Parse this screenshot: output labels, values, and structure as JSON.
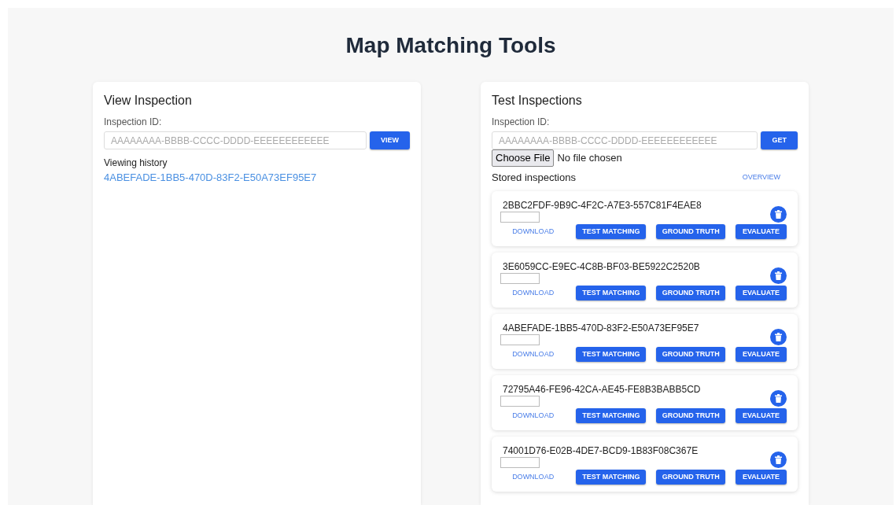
{
  "title": "Map Matching Tools",
  "view_inspection": {
    "heading": "View Inspection",
    "label": "Inspection ID:",
    "placeholder": "AAAAAAAA-BBBB-CCCC-DDDD-EEEEEEEEEEEE",
    "button": "VIEW",
    "history_label": "Viewing history",
    "history": [
      "4ABEFADE-1BB5-470D-83F2-E50A73EF95E7"
    ]
  },
  "test_inspections": {
    "heading": "Test Inspections",
    "label": "Inspection ID:",
    "placeholder": "AAAAAAAA-BBBB-CCCC-DDDD-EEEEEEEEEEEE",
    "button": "GET",
    "file_button": "Choose File",
    "file_status": "No file chosen",
    "stored_label": "Stored inspections",
    "overview": "OVERVIEW",
    "stored": [
      {
        "id": "2BBC2FDF-9B9C-4F2C-A7E3-557C81F4EAE8",
        "download": "DOWNLOAD",
        "actions": [
          "TEST MATCHING",
          "GROUND TRUTH",
          "EVALUATE"
        ]
      },
      {
        "id": "3E6059CC-E9EC-4C8B-BF03-BE5922C2520B",
        "download": "DOWNLOAD",
        "actions": [
          "TEST MATCHING",
          "GROUND TRUTH",
          "EVALUATE"
        ]
      },
      {
        "id": "4ABEFADE-1BB5-470D-83F2-E50A73EF95E7",
        "download": "DOWNLOAD",
        "actions": [
          "TEST MATCHING",
          "GROUND TRUTH",
          "EVALUATE"
        ]
      },
      {
        "id": "72795A46-FE96-42CA-AE45-FE8B3BABB5CD",
        "download": "DOWNLOAD",
        "actions": [
          "TEST MATCHING",
          "GROUND TRUTH",
          "EVALUATE"
        ]
      },
      {
        "id": "74001D76-E02B-4DE7-BCD9-1B83F08C367E",
        "download": "DOWNLOAD",
        "actions": [
          "TEST MATCHING",
          "GROUND TRUTH",
          "EVALUATE"
        ]
      }
    ]
  }
}
